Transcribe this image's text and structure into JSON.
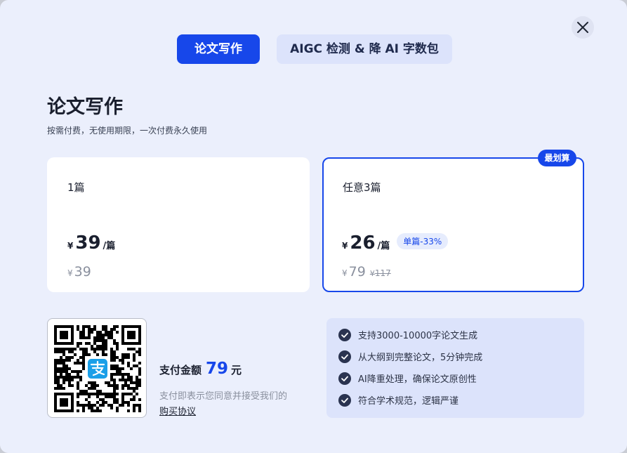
{
  "tabs": [
    {
      "label": "论文写作",
      "active": true
    },
    {
      "label": "AIGC 检测 & 降 AI 字数包",
      "active": false
    }
  ],
  "section": {
    "title": "论文写作",
    "subtitle": "按需付费，无使用期限，一次付费永久使用"
  },
  "plans": [
    {
      "name": "1篇",
      "currency": "¥",
      "price": "39",
      "unit": "/篇",
      "total_currency": "¥",
      "total": "39"
    },
    {
      "name": "任意3篇",
      "currency": "¥",
      "price": "26",
      "unit": "/篇",
      "discount_badge": "单篇-33%",
      "total_currency": "¥",
      "total": "79",
      "original_currency": "¥",
      "original_total": "117",
      "best_badge": "最划算",
      "selected": true
    }
  ],
  "payment": {
    "label": "支付金额",
    "amount": "79",
    "unit": "元",
    "agreement_text": "支付即表示您同意并接受我们的",
    "agreement_link": "购买协议"
  },
  "features": [
    "支持3000-10000字论文生成",
    "从大纲到完整论文，5分钟完成",
    "AI降重处理，确保论文原创性",
    "符合学术规范，逻辑严谨"
  ],
  "icons": {
    "close": "close-icon",
    "check": "check-circle-icon",
    "qr": "alipay-qr-code"
  },
  "colors": {
    "accent": "#1747ea",
    "background": "#ebeffc",
    "feature_panel": "#dce3fb"
  }
}
